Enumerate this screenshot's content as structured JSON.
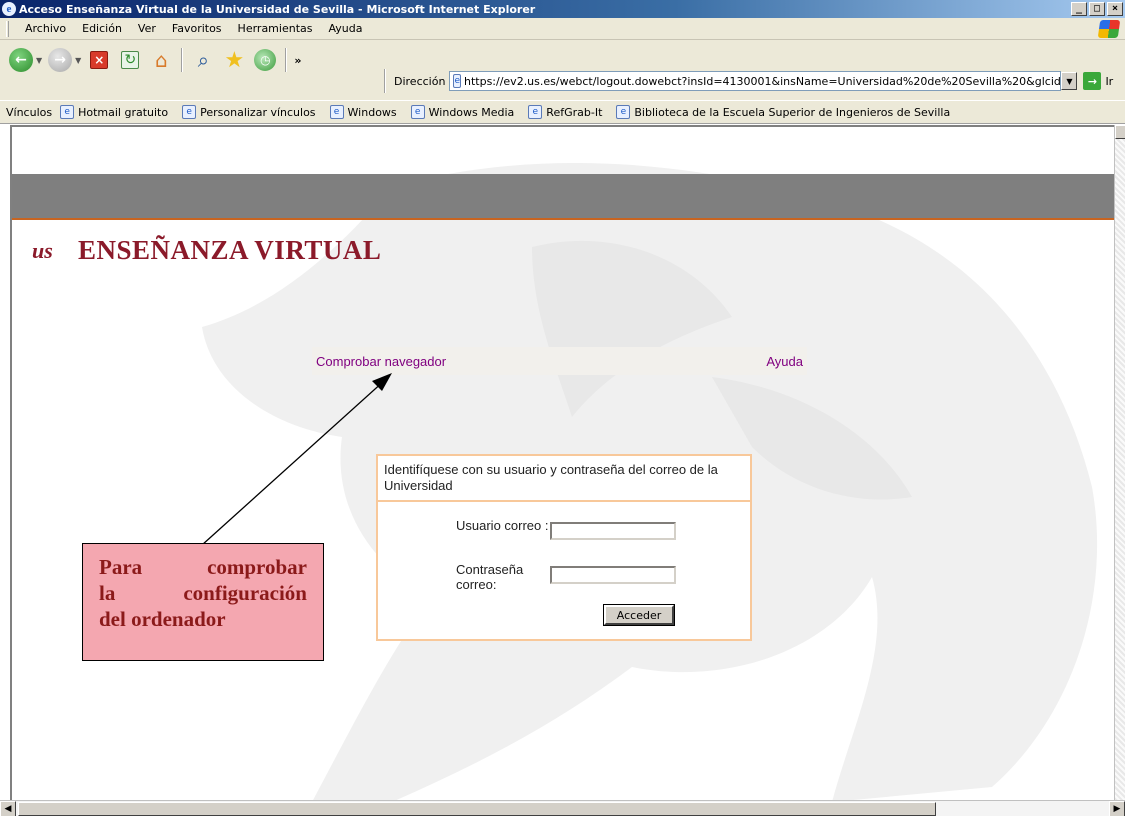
{
  "window": {
    "title": "Acceso Enseñanza Virtual de la Universidad de Sevilla - Microsoft Internet Explorer",
    "min": "_",
    "max": "□",
    "close": "×"
  },
  "menu": [
    "Archivo",
    "Edición",
    "Ver",
    "Favoritos",
    "Herramientas",
    "Ayuda"
  ],
  "toolbar": {
    "address_label": "Dirección",
    "url": "https://ev2.us.es/webct/logout.dowebct?insId=4130001&insName=Universidad%20de%20Sevilla%20&glcid",
    "go_label": "Ir",
    "more": "»"
  },
  "links": {
    "label": "Vínculos",
    "items": [
      "Hotmail gratuito",
      "Personalizar vínculos",
      "Windows",
      "Windows Media",
      "RefGrab-It",
      "Biblioteca de la Escuela Superior de Ingenieros de Sevilla"
    ]
  },
  "page": {
    "brand": "ENSEÑANZA VIRTUAL",
    "nav_check": "Comprobar navegador",
    "nav_help": "Ayuda",
    "login_title": "Identifíquese con su usuario y contraseña del correo de la Universidad",
    "user_label": "Usuario correo :",
    "user_value": "",
    "pass_label": "Contraseña correo:",
    "pass_value": "",
    "submit": "Acceder"
  },
  "callout": {
    "line1a": "Para",
    "line1b": "comprobar",
    "line2a": "la",
    "line2b": "configuración",
    "line3": "del ordenador"
  },
  "colors": {
    "brand": "#8b1a2a",
    "link": "#800080",
    "box_border": "#f8c89a",
    "callout_bg": "#f4a7b0"
  }
}
